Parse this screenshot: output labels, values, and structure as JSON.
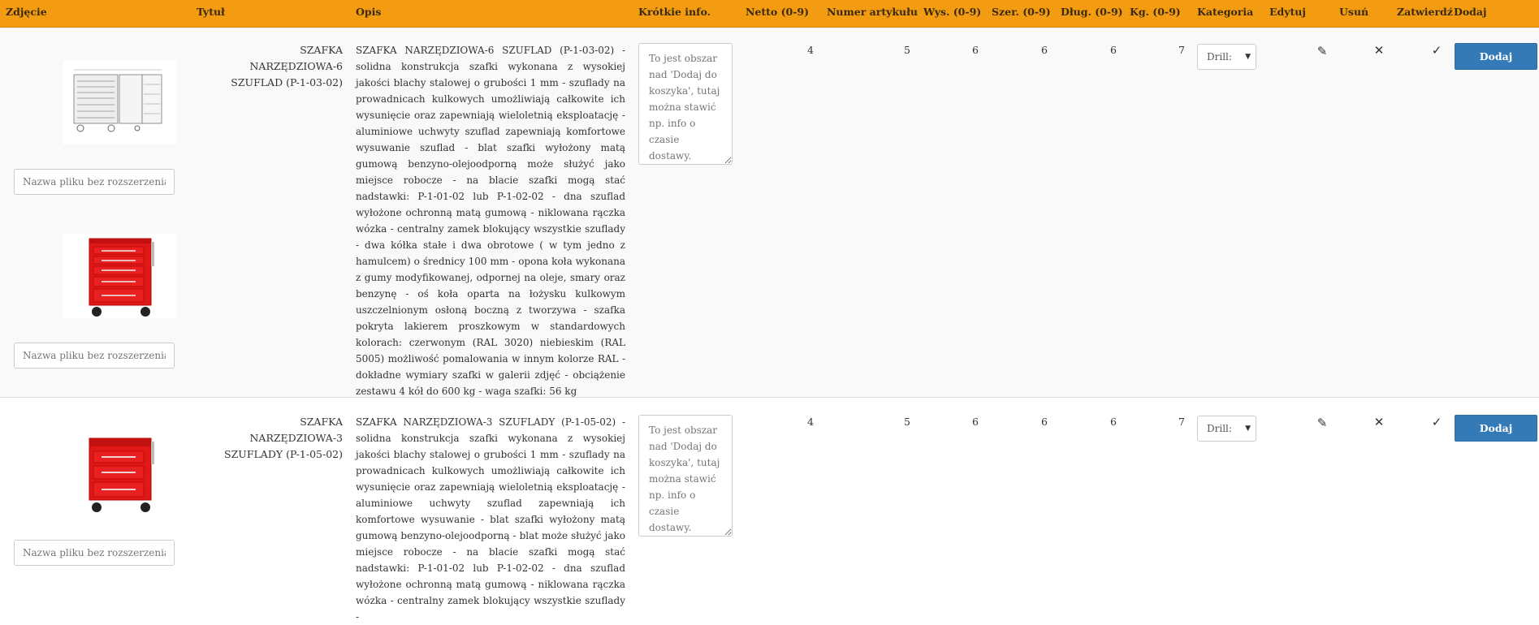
{
  "header": {
    "photo": "Zdjęcie",
    "title": "Tytuł",
    "description": "Opis",
    "short_info": "Krótkie info.",
    "net": "Netto (0-9)",
    "article_number": "Numer artykułu",
    "height": "Wys. (0-9)",
    "width": "Szer. (0-9)",
    "length": "Dług. (0-9)",
    "weight": "Kg. (0-9)",
    "category": "Kategoria",
    "edit": "Edytuj",
    "delete": "Usuń",
    "confirm": "Zatwierdź",
    "add": "Dodaj"
  },
  "rows": [
    {
      "filename_placeholder": "Nazwa pliku bez rozszerzenia!",
      "title": "SZAFKA NARZĘDZIOWA-6 SZUFLAD (P-1-03-02)",
      "description": "SZAFKA NARZĘDZIOWA-6 SZUFLAD (P-1-03-02) - solidna konstrukcja szafki wykonana z wysokiej jakości blachy stalowej o grubości 1 mm - szuflady na prowadnicach kulkowych umożliwiają całkowite ich wysunięcie oraz zapewniają wieloletnią eksploatację  - aluminiowe uchwyty szuflad zapewniają komfortowe wysuwanie szuflad - blat szafki wyłożony matą gumową benzyno-olejoodporną może służyć jako miejsce robocze - na blacie szafki mogą stać nadstawki: P-1-01-02 lub P-1-02-02 - dna szuflad wyłożone ochronną matą gumową - niklowana rączka wózka - centralny zamek blokujący wszystkie szuflady - dwa kółka stałe i dwa obrotowe ( w tym jedno z hamulcem) o średnicy 100 mm - opona koła wykonana z gumy modyfikowanej, odpornej na oleje, smary oraz benzynę - oś koła oparta na łożysku kulkowym uszczelnionym osłoną boczną z tworzywa  - szafka pokryta lakierem proszkowym w standardowych kolorach: czerwonym (RAL 3020) niebieskim (RAL 5005) możliwość pomalowania w innym kolorze RAL - dokładne wymiary szafki w galerii zdjęć  - obciążenie zestawu 4 kół do 600 kg - waga szafki: 56 kg",
      "short_info_placeholder": "To jest obszar nad 'Dodaj do koszyka', tutaj można stawić np. info o czasie dostawy.",
      "net": "4",
      "article_number": "5",
      "height": "6",
      "width": "6",
      "length": "6",
      "weight": "7",
      "category": "Drill:",
      "add_label": "Dodaj"
    },
    {
      "filename_placeholder": "Nazwa pliku bez rozszerzenia!",
      "title": "SZAFKA NARZĘDZIOWA-3 SZUFLADY (P-1-05-02)",
      "description": "SZAFKA NARZĘDZIOWA-3 SZUFLADY (P-1-05-02) - solidna konstrukcja szafki wykonana z wysokiej jakości blachy stalowej o grubości 1 mm - szuflady na prowadnicach kulkowych umożliwiają całkowite ich wysunięcie oraz zapewniają wieloletnią eksploatację - aluminiowe uchwyty szuflad zapewniają ich komfortowe wysuwanie  - blat szafki wyłożony matą gumową benzyno-olejoodporną - blat może służyć jako miejsce robocze - na blacie szafki mogą stać nadstawki: P-1-01-02 lub P-1-02-02 - dna szuflad wyłożone ochronną matą gumową - niklowana rączka wózka - centralny zamek blokujący wszystkie szuflady -",
      "short_info_placeholder": "To jest obszar nad 'Dodaj do koszyka', tutaj można stawić np. info o czasie dostawy.",
      "net": "4",
      "article_number": "5",
      "height": "6",
      "width": "6",
      "length": "6",
      "weight": "7",
      "category": "Drill:",
      "add_label": "Dodaj"
    }
  ],
  "icons": {
    "edit": "pencil-icon",
    "delete": "close-icon",
    "confirm": "checkmark-icon",
    "dropdown": "chevron-down-icon"
  },
  "colors": {
    "header_bg": "#f39c12",
    "button_bg": "#337ab7",
    "row_alt_bg": "#f9f9f9"
  }
}
